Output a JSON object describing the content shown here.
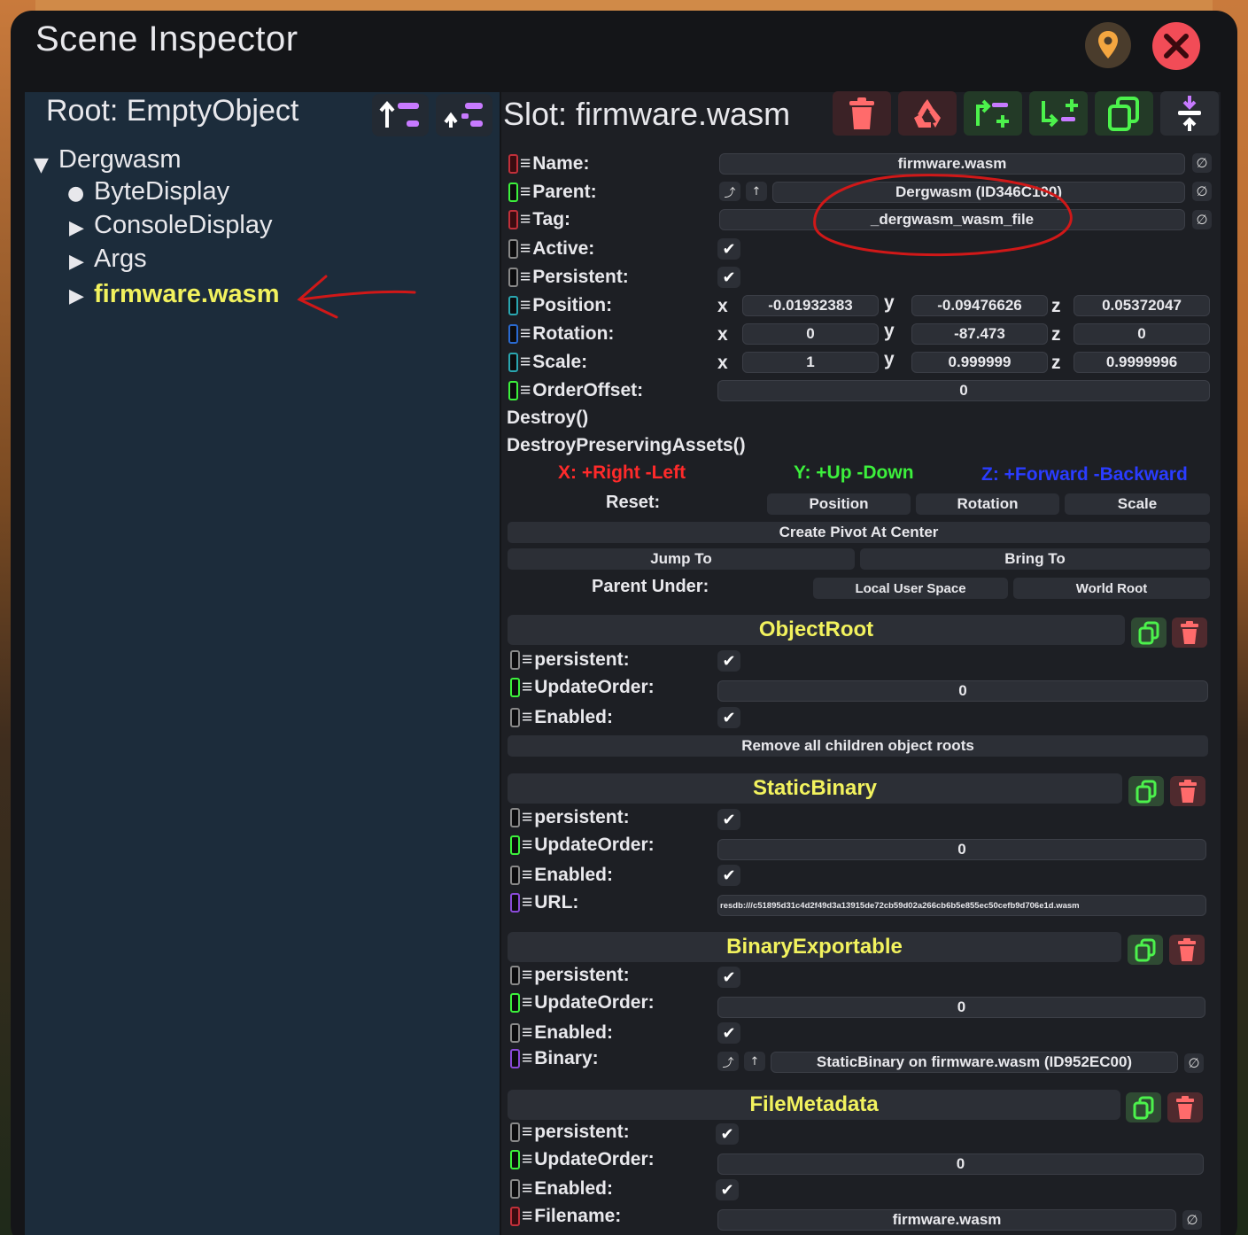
{
  "window": {
    "title": "Scene Inspector"
  },
  "hierarchy": {
    "root_label": "Root: EmptyObject",
    "items": [
      {
        "label": "Dergwasm",
        "marker": "▼"
      },
      {
        "label": "ByteDisplay",
        "marker": "●"
      },
      {
        "label": "ConsoleDisplay",
        "marker": "▶"
      },
      {
        "label": "Args",
        "marker": "▶"
      },
      {
        "label": "firmware.wasm",
        "marker": "▶",
        "selected": true
      }
    ]
  },
  "slot": {
    "header": "Slot: firmware.wasm",
    "name_label": "Name:",
    "name_value": "firmware.wasm",
    "parent_label": "Parent:",
    "parent_value": "Dergwasm (ID346C100)",
    "tag_label": "Tag:",
    "tag_value": "_dergwasm_wasm_file",
    "active_label": "Active:",
    "persistent_label": "Persistent:",
    "position_label": "Position:",
    "position": {
      "x": "-0.01932383",
      "y": "-0.09476626",
      "z": "0.05372047"
    },
    "rotation_label": "Rotation:",
    "rotation": {
      "x": "0",
      "y": "-87.473",
      "z": "0"
    },
    "scale_label": "Scale:",
    "scale": {
      "x": "1",
      "y": "0.999999",
      "z": "0.9999996"
    },
    "order_label": "OrderOffset:",
    "order_value": "0",
    "destroy": "Destroy()",
    "destroy_preserving": "DestroyPreservingAssets()",
    "axis_x": "X: +Right -Left",
    "axis_y": "Y: +Up -Down",
    "axis_z": "Z: +Forward -Backward",
    "reset_label": "Reset:",
    "reset_position": "Position",
    "reset_rotation": "Rotation",
    "reset_scale": "Scale",
    "create_pivot": "Create Pivot At Center",
    "jump_to": "Jump To",
    "bring_to": "Bring To",
    "parent_under": "Parent Under:",
    "local_user_space": "Local User Space",
    "world_root": "World Root",
    "axis_letters": {
      "x": "x",
      "y": "y",
      "z": "z"
    }
  },
  "components": {
    "object_root": {
      "title": "ObjectRoot",
      "persistent": "persistent:",
      "update_order": "UpdateOrder:",
      "update_value": "0",
      "enabled": "Enabled:",
      "remove_children": "Remove all children object roots"
    },
    "static_binary": {
      "title": "StaticBinary",
      "persistent": "persistent:",
      "update_order": "UpdateOrder:",
      "update_value": "0",
      "enabled": "Enabled:",
      "url_label": "URL:",
      "url_value": "resdb:///c51895d31c4d2f49d3a13915de72cb59d02a266cb6b5e855ec50cefb9d706e1d.wasm"
    },
    "binary_exportable": {
      "title": "BinaryExportable",
      "persistent": "persistent:",
      "update_order": "UpdateOrder:",
      "update_value": "0",
      "enabled": "Enabled:",
      "binary_label": "Binary:",
      "binary_value": "StaticBinary on firmware.wasm (ID952EC00)"
    },
    "file_metadata": {
      "title": "FileMetadata",
      "persistent": "persistent:",
      "update_order": "UpdateOrder:",
      "update_value": "0",
      "enabled": "Enabled:",
      "filename_label": "Filename:",
      "filename_value": "firmware.wasm"
    }
  },
  "colors": {
    "accent_yellow": "#f2f25e",
    "close_red": "#f24c57",
    "axis_x": "#ff2a2a",
    "axis_y": "#3cf03c",
    "axis_z": "#2a3cff",
    "annotation_red": "#d01818"
  },
  "icons": {
    "null": "∅"
  }
}
